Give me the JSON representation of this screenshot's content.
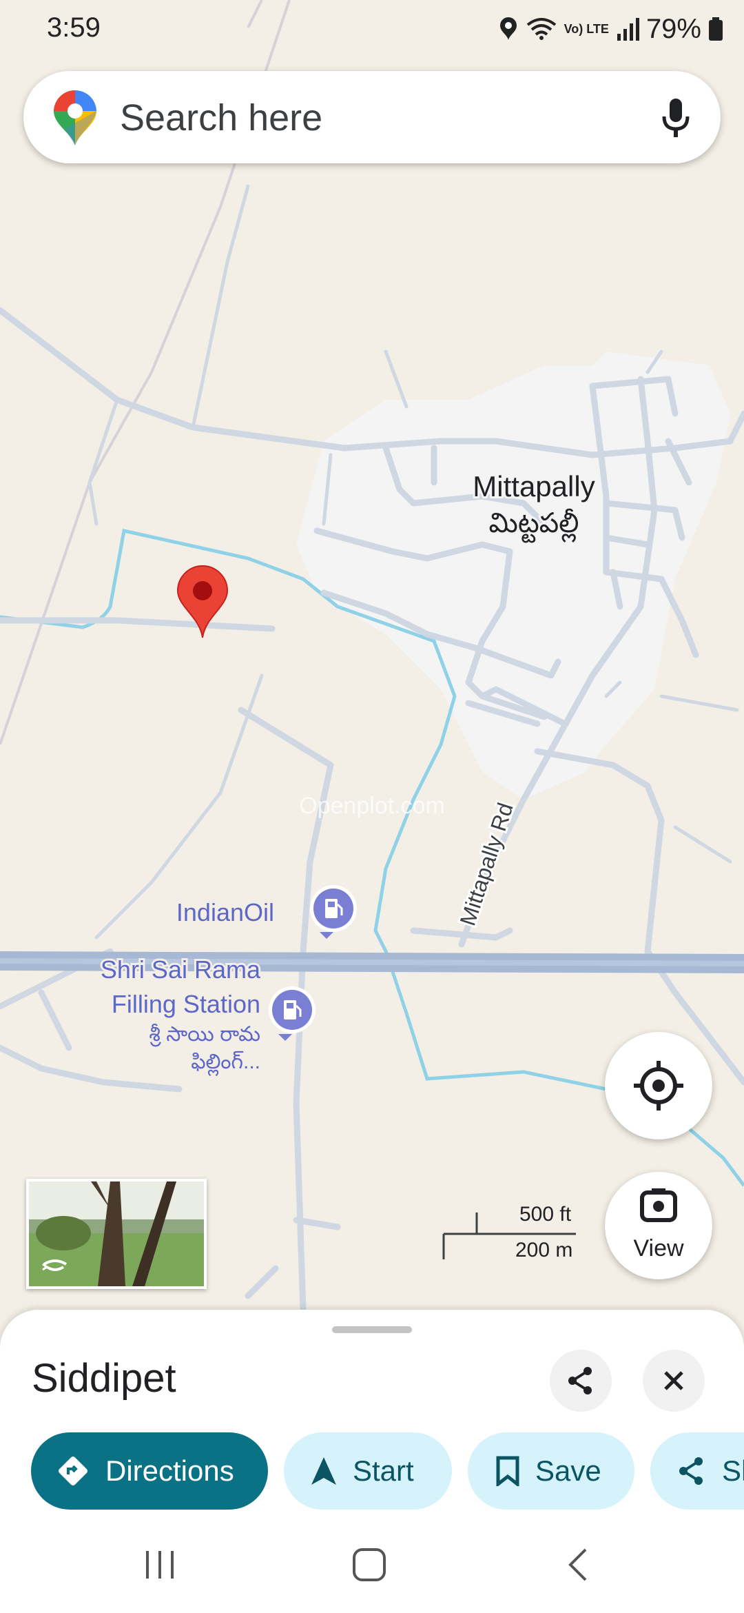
{
  "status_bar": {
    "time": "3:59",
    "battery": "79%",
    "network": "Vo) LTE",
    "icons": [
      "location-icon",
      "wifi-icon",
      "volte-icon",
      "signal-icon",
      "battery-icon"
    ]
  },
  "search": {
    "placeholder": "Search here",
    "icons": [
      "maps-logo-icon",
      "mic-icon"
    ]
  },
  "map": {
    "village_name": "Mittapally",
    "village_name_local": "మిట్టపల్లీ",
    "road_label": "Mittapally Rd",
    "poi_indianoil": "IndianOil",
    "poi_station_line1": "Shri Sai Rama",
    "poi_station_line2": "Filling Station",
    "poi_station_local_line1": "శ్రీ సాయి రామ",
    "poi_station_local_line2": "ఫిల్లింగ్...",
    "watermark": "Openplot.com",
    "scale_ft": "500 ft",
    "scale_m": "200 m",
    "view_label": "View",
    "colors": {
      "land": "#f3efe6",
      "village": "#f5f4f5",
      "road": "#cfd8e2",
      "road_edge": "#b8c4d0",
      "highway": "#a6b8d4",
      "water": "#8fd1e6",
      "pin": "#ea4335",
      "poi": "#7a7fd4"
    }
  },
  "place_sheet": {
    "title": "Siddipet",
    "actions": [
      {
        "label": "Directions",
        "icon": "directions-icon"
      },
      {
        "label": "Start",
        "icon": "navigation-arrow-icon"
      },
      {
        "label": "Save",
        "icon": "bookmark-icon"
      },
      {
        "label": "Share",
        "icon": "share-icon"
      }
    ],
    "accent": "#0b7285"
  },
  "nav_bar": {
    "icons": [
      "recent-apps-icon",
      "home-icon",
      "back-icon"
    ]
  }
}
